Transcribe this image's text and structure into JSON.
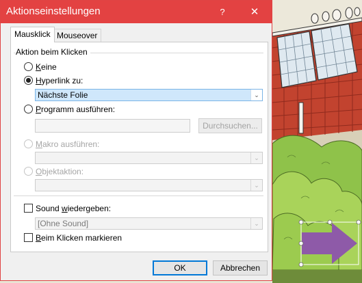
{
  "dialog": {
    "title": "Aktionseinstellungen",
    "help_symbol": "?",
    "close_symbol": "✕"
  },
  "tabs": [
    {
      "label": "Mausklick",
      "selected": true
    },
    {
      "label": "Mouseover",
      "selected": false
    }
  ],
  "group": {
    "label": "Aktion beim Klicken"
  },
  "options": {
    "keine": {
      "prefix": "",
      "accel": "K",
      "rest": "eine"
    },
    "hyperlink": {
      "prefix": "",
      "accel": "H",
      "rest": "yperlink zu:"
    },
    "programm": {
      "prefix": "",
      "accel": "P",
      "rest": "rogramm ausführen:"
    },
    "makro": {
      "prefix": "",
      "accel": "M",
      "rest": "akro ausführen:"
    },
    "objekt": {
      "prefix": "",
      "accel": "O",
      "rest": "bjektaktion:"
    }
  },
  "selected_option": "hyperlink",
  "hyperlink_select": {
    "value": "Nächste Folie"
  },
  "browse_button": {
    "label": "Durchsuchen..."
  },
  "sound": {
    "prefix": "Sound ",
    "accel": "w",
    "rest": "iedergeben:",
    "checked": false,
    "select_value": "[Ohne Sound]"
  },
  "highlight": {
    "prefix": "",
    "accel": "B",
    "rest": "eim Klicken markieren",
    "checked": false
  },
  "footer": {
    "ok_label": "OK",
    "cancel_label": "Abbrechen"
  },
  "colors": {
    "titlebar": "#e34242",
    "select_active": "#cfe7fb",
    "primary_border": "#0078d7",
    "slide_arrow": "#8e5aa8"
  },
  "slide": {
    "icons": [
      "birds-icon",
      "solar-panel-icon",
      "roof-icon",
      "tree-icon",
      "arrow-right-icon"
    ]
  }
}
